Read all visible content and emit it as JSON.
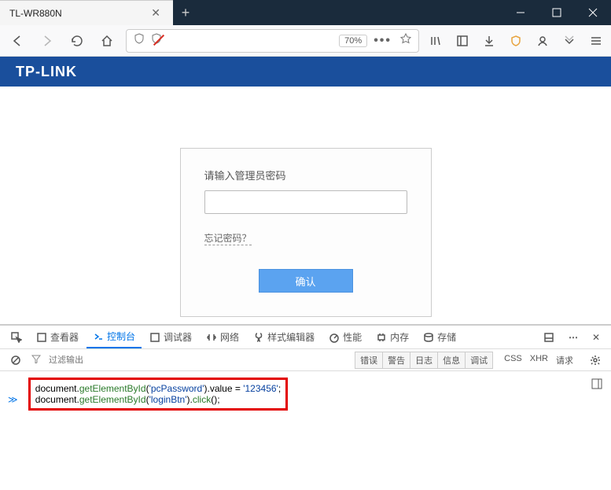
{
  "titlebar": {
    "tab_title": "TL-WR880N"
  },
  "toolbar": {
    "zoom": "70%"
  },
  "page": {
    "brand": "TP-LINK",
    "login_label": "请输入管理员密码",
    "forgot": "忘记密码？",
    "confirm": "确认"
  },
  "devtools": {
    "tabs": {
      "inspector": "查看器",
      "console": "控制台",
      "debugger": "调试器",
      "network": "网络",
      "style": "样式编辑器",
      "performance": "性能",
      "memory": "内存",
      "storage": "存储"
    },
    "filter_placeholder": "过滤输出",
    "levels": [
      "错误",
      "警告",
      "日志",
      "信息",
      "调试"
    ],
    "extra": [
      "CSS",
      "XHR",
      "请求"
    ],
    "code": {
      "l1a": "document.",
      "l1b": "getElementById",
      "l1c": "(",
      "l1d": "'pcPassword'",
      "l1e": ").value = ",
      "l1f": "'123456'",
      "l1g": ";",
      "l2a": "document.",
      "l2b": "getElementById",
      "l2c": "(",
      "l2d": "'loginBtn'",
      "l2e": ").",
      "l2f": "click",
      "l2g": "();"
    }
  }
}
